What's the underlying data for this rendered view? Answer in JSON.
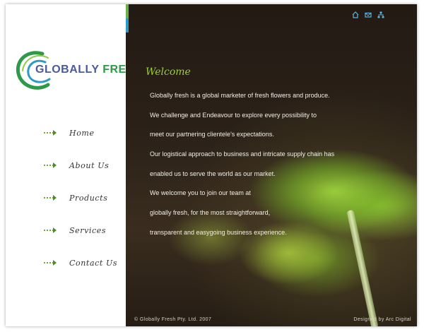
{
  "brand": {
    "logo_word1": "GLOBALLY",
    "logo_word2": "FRESH",
    "logo_icon": "swirl-logo-icon"
  },
  "colors": {
    "accent_green": "#9ccf3a",
    "nav_arrow": "#4e8c24",
    "logo_blue": "#4a5a9c",
    "logo_green": "#2c9a48",
    "accent_blue": "#2d9ac4"
  },
  "header": {
    "icons": [
      "home-icon",
      "mail-icon",
      "sitemap-icon"
    ]
  },
  "nav": {
    "items": [
      {
        "label": "Home"
      },
      {
        "label": "About Us"
      },
      {
        "label": "Products"
      },
      {
        "label": "Services"
      },
      {
        "label": "Contact Us"
      }
    ]
  },
  "main": {
    "heading": "Welcome",
    "paragraphs": [
      "Globally fresh is a global marketer of fresh flowers and produce.",
      "We challenge and Endeavour to explore every possibility to",
      "meet our partnering clientele's expectations.",
      "Our logistical approach to business and intricate supply chain has",
      " enabled us to serve the world as our market.",
      "We welcome you to join our team at",
      "globally fresh, for the most straightforward,",
      " transparent and easygoing business experience."
    ]
  },
  "footer": {
    "copyright": "© Globally Fresh Pty. Ltd. 2007",
    "credit": "Designed by Arc Digital"
  }
}
